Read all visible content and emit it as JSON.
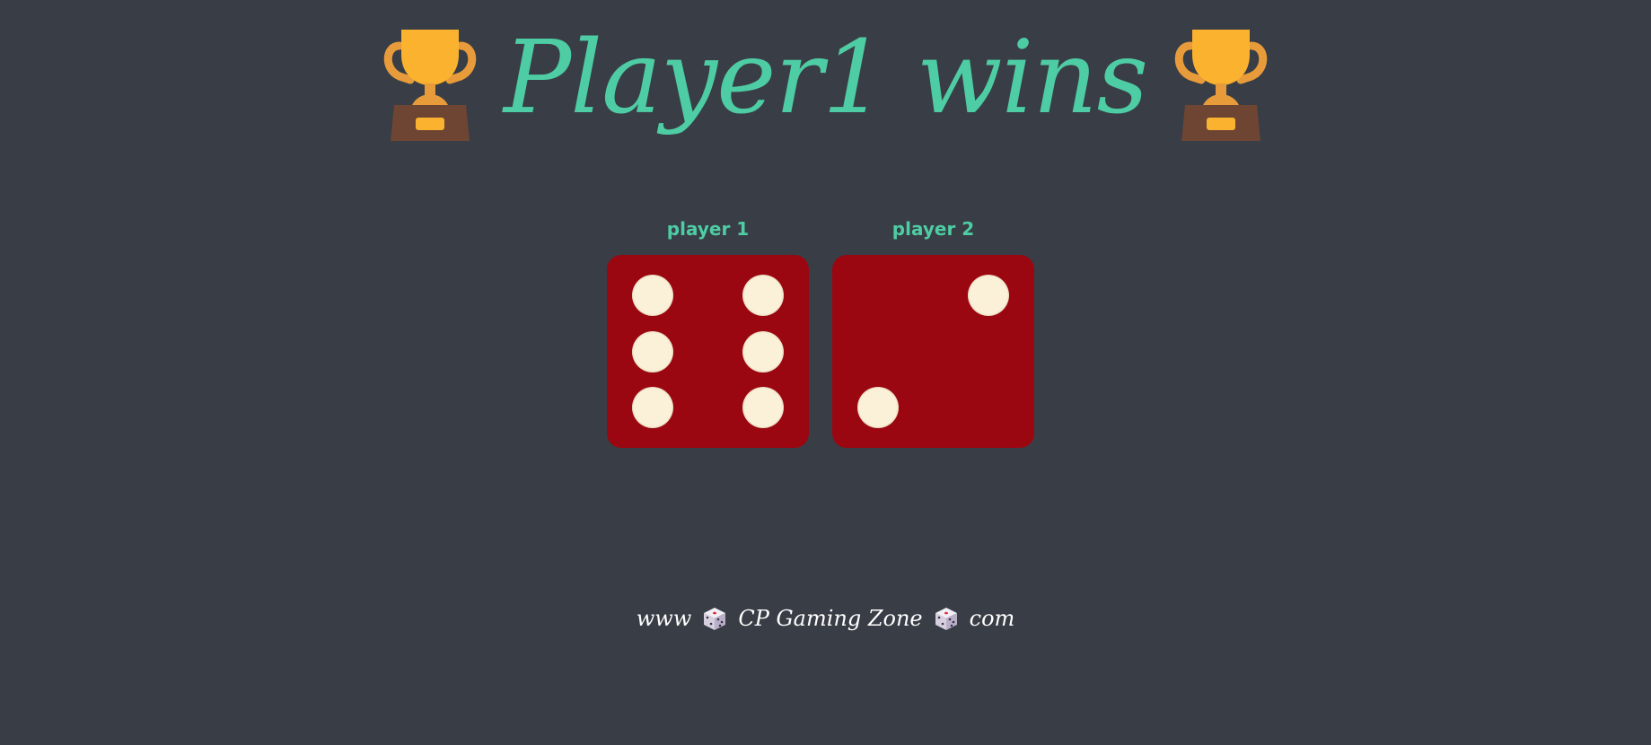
{
  "title": {
    "text": "Player1 wins",
    "color": "#4ecca3",
    "left_icon": "trophy-icon",
    "right_icon": "trophy-icon"
  },
  "players": [
    {
      "label": "player 1",
      "die_value": 6
    },
    {
      "label": "player 2",
      "die_value": 2
    }
  ],
  "die_colors": {
    "face": "#9a0710",
    "pip": "#fbf1d9"
  },
  "footer": {
    "prefix": "www",
    "name": "CP Gaming Zone",
    "suffix": "com",
    "icon": "dice-icon"
  },
  "background": "#393e46"
}
